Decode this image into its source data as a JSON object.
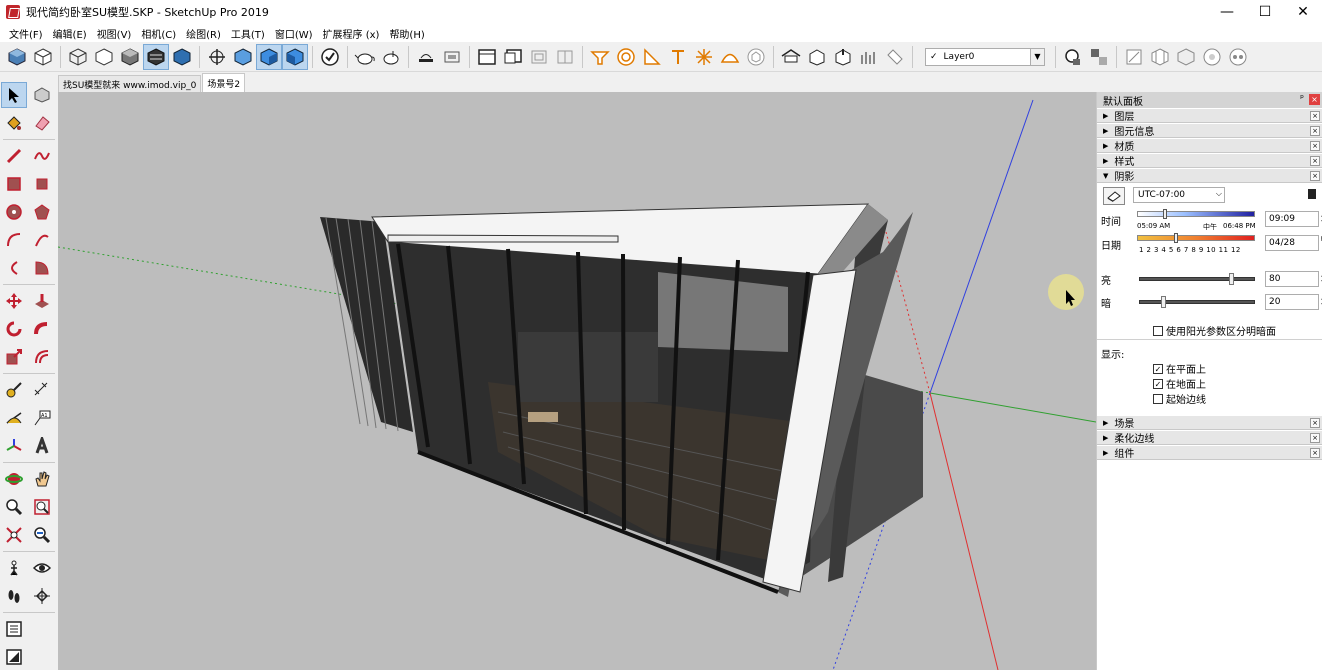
{
  "window": {
    "title": "现代简约卧室SU模型.SKP - SketchUp Pro 2019",
    "minimize": "—",
    "maximize": "☐",
    "close": "✕"
  },
  "menu": [
    {
      "label": "文件(F)"
    },
    {
      "label": "编辑(E)"
    },
    {
      "label": "视图(V)"
    },
    {
      "label": "相机(C)"
    },
    {
      "label": "绘图(R)"
    },
    {
      "label": "工具(T)"
    },
    {
      "label": "窗口(W)"
    },
    {
      "label": "扩展程序 (x)"
    },
    {
      "label": "帮助(H)"
    }
  ],
  "toolbar": {
    "layer_check": "✓",
    "layer_value": "Layer0"
  },
  "tabs": [
    {
      "label": "找SU模型就来 www.imod.vip_0"
    },
    {
      "label": "场景号2"
    }
  ],
  "panel": {
    "title": "默认面板",
    "pin": "ᵖ",
    "close": "×",
    "trays_top": [
      {
        "label": "图层",
        "arrow": "▶"
      },
      {
        "label": "图元信息",
        "arrow": "▶"
      },
      {
        "label": "材质",
        "arrow": "▶"
      },
      {
        "label": "样式",
        "arrow": "▶"
      }
    ],
    "shadows": {
      "label": "阴影",
      "arrow": "▼",
      "timezone": "UTC-07:00",
      "time_label": "时间",
      "time_start": "05:09 AM",
      "time_mid": "中午",
      "time_end": "06:48 PM",
      "time_value": "09:09",
      "time_fraction": 0.22,
      "date_label": "日期",
      "months": "1 2 3 4 5 6 7 8 9 10 11 12",
      "date_value": "04/28",
      "date_fraction": 0.32,
      "light_label": "亮",
      "light_value": "80",
      "light_fraction": 0.8,
      "dark_label": "暗",
      "dark_value": "20",
      "dark_fraction": 0.2,
      "sun_for_shading": "使用阳光参数区分明暗面",
      "display_label": "显示:",
      "on_faces": "在平面上",
      "on_ground": "在地面上",
      "from_edges": "起始边线",
      "check_mark": "✓"
    },
    "trays_bottom": [
      {
        "label": "场景",
        "arrow": "▶"
      },
      {
        "label": "柔化边线",
        "arrow": "▶"
      },
      {
        "label": "组件",
        "arrow": "▶"
      }
    ]
  },
  "colors": {
    "viewport_bg": "#bdbdbd",
    "axis_red": "#e03030",
    "axis_green": "#30a030",
    "axis_blue": "#3040e0",
    "accent_orange": "#e07a00"
  }
}
